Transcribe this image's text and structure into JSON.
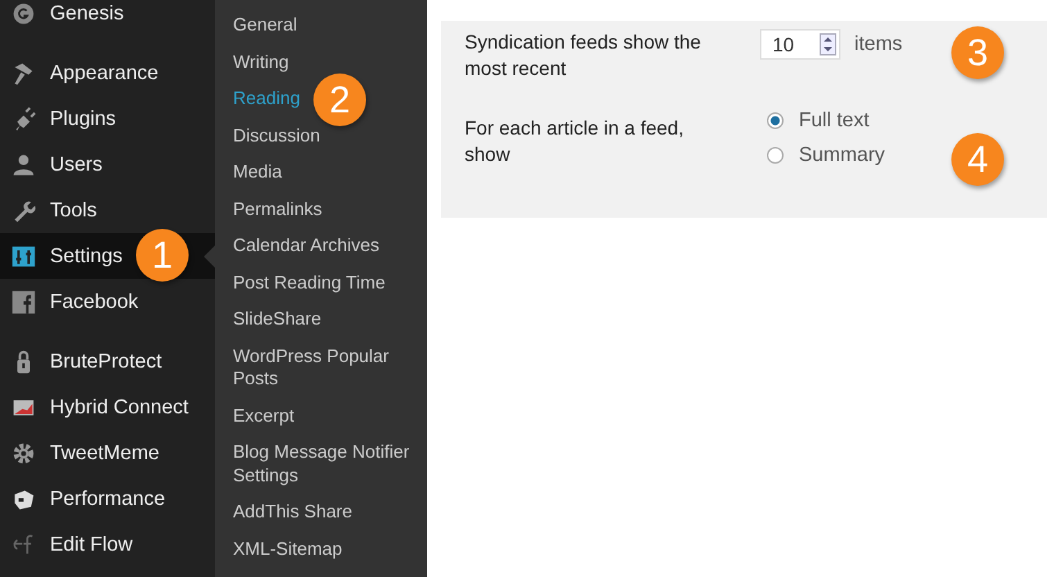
{
  "menu_groups": [
    [
      {
        "label": "Genesis",
        "selected": false
      }
    ],
    [
      {
        "label": "Appearance",
        "selected": false
      },
      {
        "label": "Plugins",
        "selected": false
      },
      {
        "label": "Users",
        "selected": false
      },
      {
        "label": "Tools",
        "selected": false
      },
      {
        "label": "Settings",
        "selected": true,
        "callout": "1"
      },
      {
        "label": "Facebook",
        "selected": false
      }
    ],
    [
      {
        "label": "BruteProtect",
        "selected": false
      },
      {
        "label": "Hybrid Connect",
        "selected": false
      },
      {
        "label": "TweetMeme",
        "selected": false
      },
      {
        "label": "Performance",
        "selected": false
      },
      {
        "label": "Edit Flow",
        "selected": false
      }
    ]
  ],
  "submenu": [
    {
      "label": "General",
      "selected": false
    },
    {
      "label": "Writing",
      "selected": false
    },
    {
      "label": "Reading",
      "selected": true,
      "callout": "2"
    },
    {
      "label": "Discussion",
      "selected": false
    },
    {
      "label": "Media",
      "selected": false
    },
    {
      "label": "Permalinks",
      "selected": false
    },
    {
      "label": "Calendar Archives",
      "selected": false
    },
    {
      "label": "Post Reading Time",
      "selected": false
    },
    {
      "label": "SlideShare",
      "selected": false
    },
    {
      "label": "WordPress Popular Posts",
      "selected": false
    },
    {
      "label": "Excerpt",
      "selected": false
    },
    {
      "label": "Blog Message Notifier Settings",
      "selected": false
    },
    {
      "label": "AddThis Share",
      "selected": false
    },
    {
      "label": "XML-Sitemap",
      "selected": false
    }
  ],
  "settings": [
    {
      "kind": "number",
      "label": "Syndication feeds show the most recent",
      "value": "10",
      "unit": "items",
      "callout": "3"
    },
    {
      "kind": "radio",
      "label": "For each article in a feed, show",
      "callout": "4",
      "options": [
        {
          "label": "Full text",
          "selected": true
        },
        {
          "label": "Summary",
          "selected": false
        }
      ]
    }
  ]
}
